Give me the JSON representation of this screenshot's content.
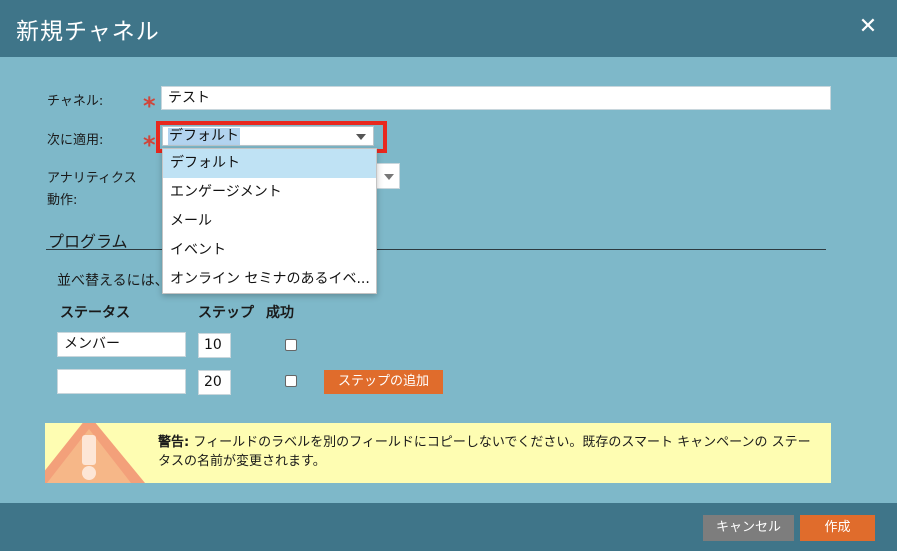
{
  "dialog": {
    "title": "新規チャネル",
    "close_icon": "close-icon"
  },
  "form": {
    "channel_label": "チャネル:",
    "channel_value": "テスト",
    "apply_label": "次に適用:",
    "apply_value": "デフォルト",
    "analytics_label_line1": "アナリティクス",
    "analytics_label_line2": "動作:",
    "required_mark": "*"
  },
  "dropdown": {
    "options": [
      "デフォルト",
      "エンゲージメント",
      "メール",
      "イベント",
      "オンライン セミナのあるイベ..."
    ],
    "selected_index": 0
  },
  "program": {
    "section_title": "プログラム",
    "hint": "並べ替えるには、",
    "headers": {
      "status": "ステータス",
      "step": "ステップ",
      "success": "成功"
    },
    "rows": [
      {
        "status": "メンバー",
        "step": "10",
        "success": false
      },
      {
        "status": "",
        "step": "20",
        "success": false
      }
    ],
    "add_step_label": "ステップの追加"
  },
  "warning": {
    "bold": "警告:",
    "text": " フィールドのラベルを別のフィールドにコピーしないでください。既存のスマート キャンペーンの ステータスの名前が変更されます。"
  },
  "footer": {
    "cancel_label": "キャンセル",
    "create_label": "作成"
  },
  "colors": {
    "header": "#3f7589",
    "body": "#7eb8c9",
    "accent": "#e06c2c",
    "highlight": "#e8281e",
    "warning_bg": "#fefdb2"
  }
}
